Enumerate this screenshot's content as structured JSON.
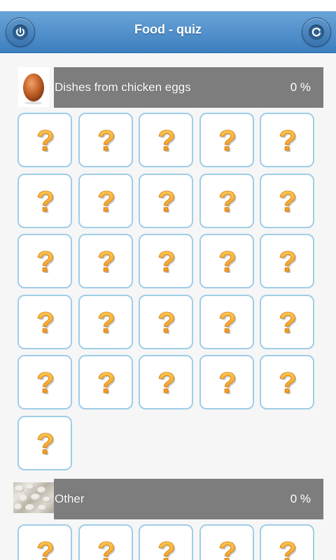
{
  "header": {
    "title": "Food - quiz",
    "left_icon": "power-icon",
    "right_icon": "refresh-icon"
  },
  "sections": [
    {
      "title": "Dishes from chicken eggs",
      "percent": "0 %",
      "thumbnail": "egg-image",
      "tile_count": 26,
      "tile_symbol": "?"
    },
    {
      "title": "Other",
      "percent": "0 %",
      "thumbnail": "pebbles-image",
      "tile_count": 5,
      "tile_symbol": "?"
    }
  ],
  "colors": {
    "header": "#4a8bc8",
    "section_bar": "#7d7d7d",
    "tile_border": "#9fcde8",
    "question_mark": "#f4a21c"
  }
}
